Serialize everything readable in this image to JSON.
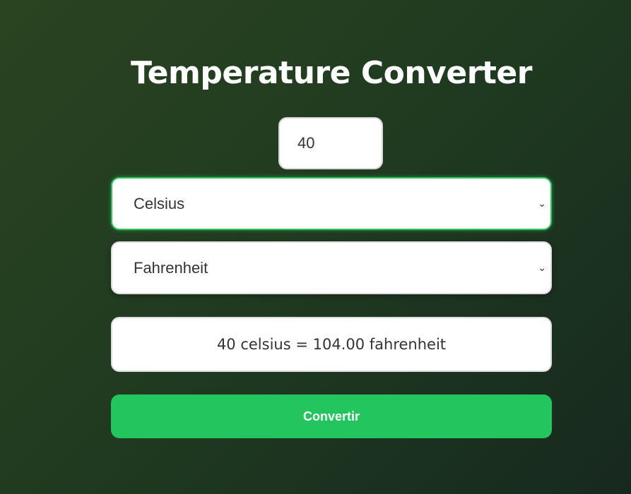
{
  "title": "Temperature Converter",
  "input": {
    "value": "40"
  },
  "from_select": {
    "selected": "Celsius"
  },
  "to_select": {
    "selected": "Fahrenheit"
  },
  "result": "40 celsius = 104.00 fahrenheit",
  "convert_button": "Convertir",
  "colors": {
    "accent": "#22c55e"
  }
}
